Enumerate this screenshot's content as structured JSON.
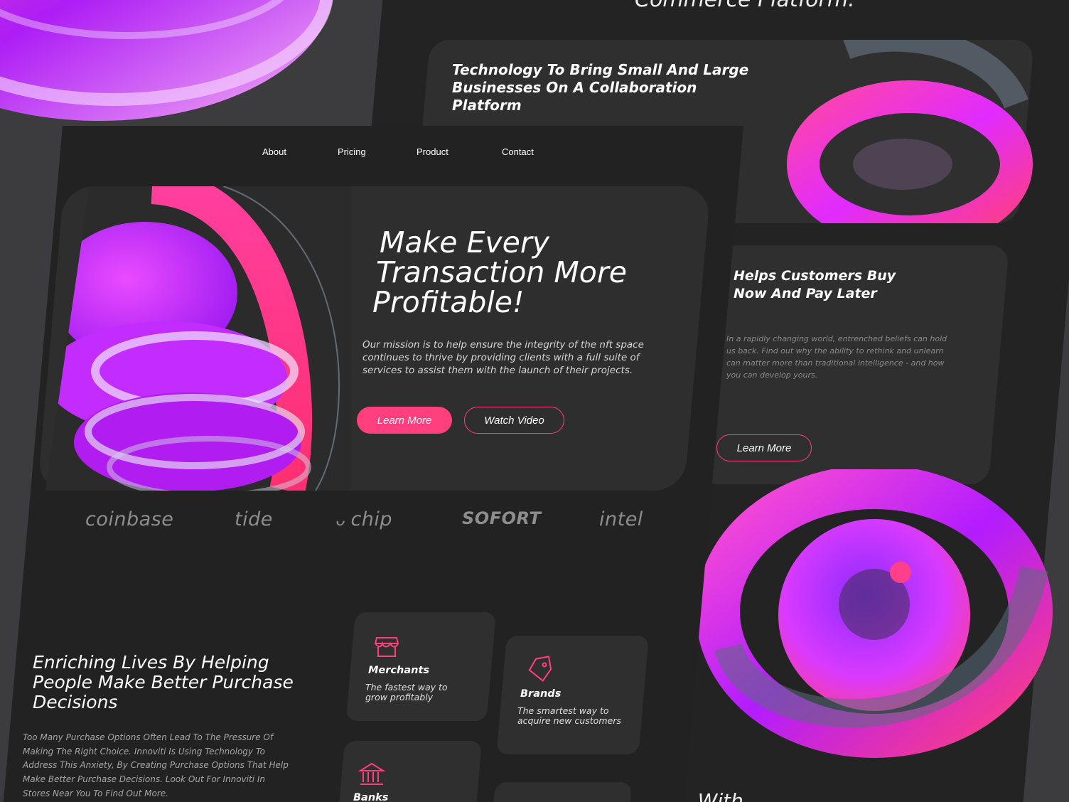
{
  "back_screen": {
    "heading": "Commerce Platform.",
    "card_top_title": "Technology To Bring Small And Large Businesses On A Collaboration Platform",
    "card_mid_title": "Helps Customers Buy Now And Pay Later",
    "card_mid_body": "In a rapidly changing world, entrenched beliefs can hold us back. Find out why the ability to rethink and unlearn can matter more than traditional intelligence - and how you can develop yours.",
    "card_mid_button": "Learn More",
    "footer_heading": "...With"
  },
  "nav": {
    "items": [
      {
        "label": "About"
      },
      {
        "label": "Pricing"
      },
      {
        "label": "Product"
      },
      {
        "label": "Contact"
      }
    ]
  },
  "hero": {
    "title_line1": "Make Every",
    "title_line2": "Transaction More",
    "title_line3": "Profitable!",
    "subtitle": "Our mission is to help ensure the integrity of the nft space continues to thrive by providing clients with a full suite of services to assist them with the launch of their projects.",
    "primary_button": "Learn More",
    "secondary_button": "Watch Video"
  },
  "logos": [
    "coinbase",
    "tide",
    "chip",
    "SOFORT",
    "intel"
  ],
  "enrich": {
    "title": "Enriching Lives By Helping People Make Better Purchase Decisions",
    "body": "Too Many Purchase Options Often Lead To The Pressure Of Making The Right Choice. Innoviti Is Using Technology To Address This Anxiety, By Creating Purchase Options That Help Make Better Purchase Decisions. Look Out For Innoviti In Stores Near You To Find Out More."
  },
  "features": [
    {
      "title": "Merchants",
      "desc": "The fastest way to grow profitably",
      "icon": "storefront-icon"
    },
    {
      "title": "Brands",
      "desc": "The smartest way to acquire new customers",
      "icon": "tag-icon"
    },
    {
      "title": "Banks",
      "desc": "",
      "icon": "bank-icon"
    }
  ],
  "colors": {
    "accent": "#ff3f7e",
    "magenta": "#d62bff",
    "background": "#222222",
    "card": "#2e2e2f"
  }
}
